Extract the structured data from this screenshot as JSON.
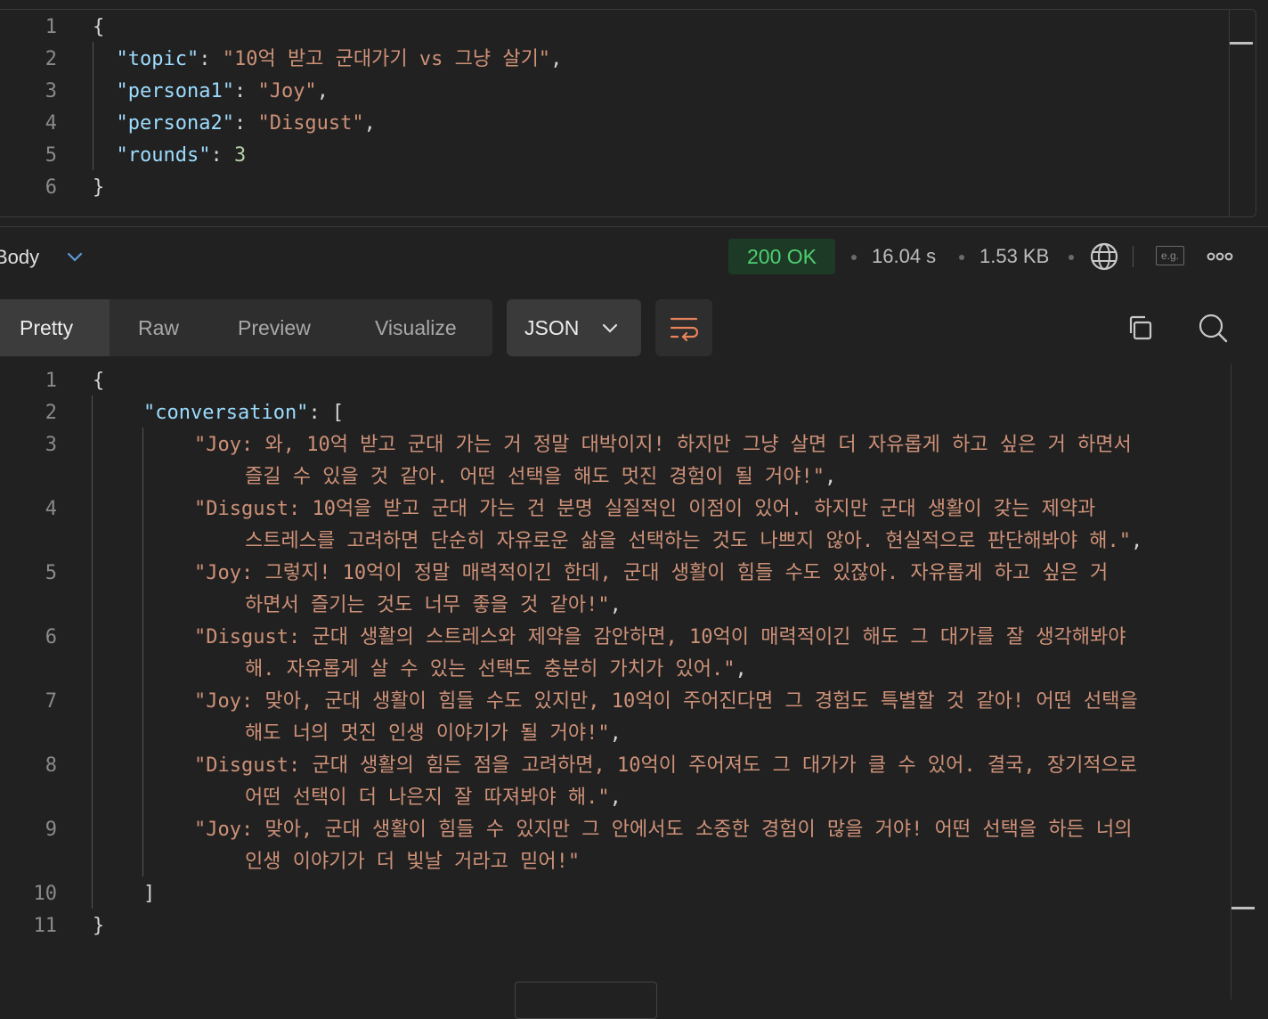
{
  "request": {
    "lines": [
      {
        "n": "1",
        "parts": [
          [
            "p",
            "{"
          ]
        ]
      },
      {
        "n": "2",
        "parts": [
          [
            "k",
            "  \"topic\""
          ],
          [
            "p",
            ": "
          ],
          [
            "s",
            "\"10억 받고 군대가기 vs 그냥 살기\""
          ],
          [
            "p",
            ","
          ]
        ]
      },
      {
        "n": "3",
        "parts": [
          [
            "k",
            "  \"persona1\""
          ],
          [
            "p",
            ": "
          ],
          [
            "s",
            "\"Joy\""
          ],
          [
            "p",
            ","
          ]
        ]
      },
      {
        "n": "4",
        "parts": [
          [
            "k",
            "  \"persona2\""
          ],
          [
            "p",
            ": "
          ],
          [
            "s",
            "\"Disgust\""
          ],
          [
            "p",
            ","
          ]
        ]
      },
      {
        "n": "5",
        "parts": [
          [
            "k",
            "  \"rounds\""
          ],
          [
            "p",
            ": "
          ],
          [
            "n",
            "3"
          ]
        ]
      },
      {
        "n": "6",
        "parts": [
          [
            "p",
            "}"
          ]
        ]
      }
    ]
  },
  "response_header": {
    "body_label": "Body",
    "status": "200 OK",
    "time": "16.04 s",
    "size": "1.53 KB",
    "example_label": "e.g."
  },
  "view_tabs": [
    "Pretty",
    "Raw",
    "Preview",
    "Visualize"
  ],
  "active_tab": "Pretty",
  "format": "JSON",
  "response": {
    "line_numbers": [
      {
        "n": "1",
        "row": 0
      },
      {
        "n": "2",
        "row": 1
      },
      {
        "n": "3",
        "row": 2
      },
      {
        "n": "4",
        "row": 4
      },
      {
        "n": "5",
        "row": 6
      },
      {
        "n": "6",
        "row": 8
      },
      {
        "n": "7",
        "row": 10
      },
      {
        "n": "8",
        "row": 12
      },
      {
        "n": "9",
        "row": 14
      },
      {
        "n": "10",
        "row": 16
      },
      {
        "n": "11",
        "row": 17
      }
    ],
    "rows": [
      {
        "indent": 0,
        "parts": [
          [
            "p",
            "{"
          ]
        ]
      },
      {
        "indent": 1,
        "parts": [
          [
            "k",
            "\"conversation\""
          ],
          [
            "p",
            ": ["
          ]
        ]
      },
      {
        "indent": 2,
        "parts": [
          [
            "s",
            "\"Joy: 와, 10억 받고 군대 가는 거 정말 대박이지! 하지만 그냥 살면 더 자유롭게 하고 싶은 거 하면서"
          ]
        ]
      },
      {
        "indent": 3,
        "parts": [
          [
            "s",
            "즐길 수 있을 것 같아. 어떤 선택을 해도 멋진 경험이 될 거야!\""
          ],
          [
            "p",
            ","
          ]
        ]
      },
      {
        "indent": 2,
        "parts": [
          [
            "s",
            "\"Disgust: 10억을 받고 군대 가는 건 분명 실질적인 이점이 있어. 하지만 군대 생활이 갖는 제약과"
          ]
        ]
      },
      {
        "indent": 3,
        "parts": [
          [
            "s",
            "스트레스를 고려하면 단순히 자유로운 삶을 선택하는 것도 나쁘지 않아. 현실적으로 판단해봐야 해.\""
          ],
          [
            "p",
            ","
          ]
        ]
      },
      {
        "indent": 2,
        "parts": [
          [
            "s",
            "\"Joy: 그렇지! 10억이 정말 매력적이긴 한데, 군대 생활이 힘들 수도 있잖아. 자유롭게 하고 싶은 거"
          ]
        ]
      },
      {
        "indent": 3,
        "parts": [
          [
            "s",
            "하면서 즐기는 것도 너무 좋을 것 같아!\""
          ],
          [
            "p",
            ","
          ]
        ]
      },
      {
        "indent": 2,
        "parts": [
          [
            "s",
            "\"Disgust: 군대 생활의 스트레스와 제약을 감안하면, 10억이 매력적이긴 해도 그 대가를 잘 생각해봐야"
          ]
        ]
      },
      {
        "indent": 3,
        "parts": [
          [
            "s",
            "해. 자유롭게 살 수 있는 선택도 충분히 가치가 있어.\""
          ],
          [
            "p",
            ","
          ]
        ]
      },
      {
        "indent": 2,
        "parts": [
          [
            "s",
            "\"Joy: 맞아, 군대 생활이 힘들 수도 있지만, 10억이 주어진다면 그 경험도 특별할 것 같아! 어떤 선택을"
          ]
        ]
      },
      {
        "indent": 3,
        "parts": [
          [
            "s",
            "해도 너의 멋진 인생 이야기가 될 거야!\""
          ],
          [
            "p",
            ","
          ]
        ]
      },
      {
        "indent": 2,
        "parts": [
          [
            "s",
            "\"Disgust: 군대 생활의 힘든 점을 고려하면, 10억이 주어져도 그 대가가 클 수 있어. 결국, 장기적으로"
          ]
        ]
      },
      {
        "indent": 3,
        "parts": [
          [
            "s",
            "어떤 선택이 더 나은지 잘 따져봐야 해.\""
          ],
          [
            "p",
            ","
          ]
        ]
      },
      {
        "indent": 2,
        "parts": [
          [
            "s",
            "\"Joy: 맞아, 군대 생활이 힘들 수 있지만 그 안에서도 소중한 경험이 많을 거야! 어떤 선택을 하든 너의"
          ]
        ]
      },
      {
        "indent": 3,
        "parts": [
          [
            "s",
            "인생 이야기가 더 빛날 거라고 믿어!\""
          ]
        ]
      },
      {
        "indent": 1,
        "parts": [
          [
            "p",
            "]"
          ]
        ]
      },
      {
        "indent": 0,
        "parts": [
          [
            "p",
            "}"
          ]
        ]
      }
    ]
  },
  "colors": {
    "key": "#9cdcfe",
    "string": "#ce9178",
    "number": "#b5cea8",
    "status_bg": "#1d3a26",
    "status_text": "#4fcf70",
    "wrap_icon": "#e8825a"
  },
  "icons": [
    "chevron-down-icon",
    "globe-icon",
    "example-icon",
    "more-icon",
    "wrap-lines-icon",
    "copy-icon",
    "search-icon"
  ]
}
